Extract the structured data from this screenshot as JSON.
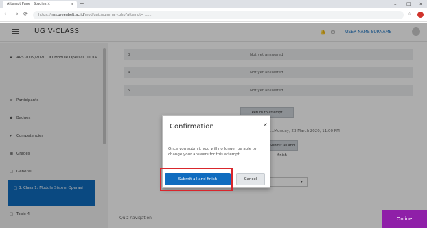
{
  "browser": {
    "tab_title": "Attempt Page | Studies ×",
    "tab_close": "×",
    "new_tab": "+",
    "url_prefix": "https://",
    "url_host": "lms.greenbelt.ac.id",
    "url_rest": "/mod/quiz/summary.php?attempt=  ......",
    "window_controls": [
      "–",
      "□",
      "×"
    ],
    "nav_icons": [
      "←",
      "→",
      "⟳"
    ]
  },
  "header": {
    "brand": "UG V-CLASS",
    "username": "USER NAME SURNAME"
  },
  "drawer": {
    "items": [
      {
        "icon": "graduation-cap-icon",
        "glyph": "🎓",
        "label": "APS 2019/2020 DKI Module Operasi TODIA"
      },
      {
        "icon": "gear-icon",
        "glyph": "☰",
        "label": "Participants"
      },
      {
        "icon": "shield-icon",
        "glyph": "◆",
        "label": "Badges"
      },
      {
        "icon": "check-icon",
        "glyph": "✔",
        "label": "Competencies"
      },
      {
        "icon": "table-icon",
        "glyph": "▦",
        "label": "Grades"
      },
      {
        "icon": "folder-icon",
        "glyph": "▢",
        "label": "General"
      }
    ],
    "active_item": "3. Class 1: Module Sistem Operasi",
    "bottom_item": "Topic 4"
  },
  "main": {
    "rows": [
      {
        "num": "3",
        "state": "Not yet answered"
      },
      {
        "num": "4",
        "state": "Not yet answered"
      },
      {
        "num": "5",
        "state": "Not yet answered"
      }
    ],
    "return_button": "Return to attempt",
    "deadline_text": "...Monday, 23 March 2020, 11:00 PM",
    "submit_button": "Submit all and finish",
    "quiz_navigation": "Quiz navigation"
  },
  "modal": {
    "title": "Confirmation",
    "close": "×",
    "body": "Once you submit, you will no longer be able to change your answers for this attempt.",
    "submit_label": "Submit all and finish",
    "cancel_label": "Cancel"
  },
  "badge": {
    "label": "Online"
  }
}
